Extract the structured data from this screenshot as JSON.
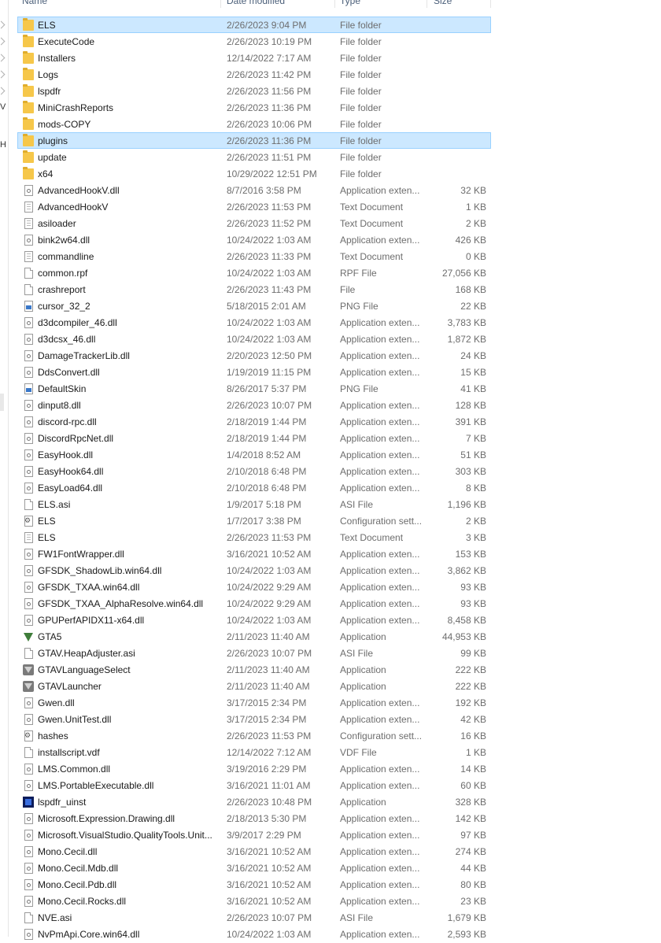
{
  "header": {
    "name": "Name",
    "date_modified": "Date modified",
    "type": "Type",
    "size": "Size"
  },
  "nav_fragments": [
    "V",
    "H"
  ],
  "files": [
    {
      "name": "ELS",
      "date": "2/26/2023 9:04 PM",
      "type": "File folder",
      "size": "",
      "icon": "folder",
      "selected": "hover"
    },
    {
      "name": "ExecuteCode",
      "date": "2/26/2023 10:19 PM",
      "type": "File folder",
      "size": "",
      "icon": "folder"
    },
    {
      "name": "Installers",
      "date": "12/14/2022 7:17 AM",
      "type": "File folder",
      "size": "",
      "icon": "folder"
    },
    {
      "name": "Logs",
      "date": "2/26/2023 11:42 PM",
      "type": "File folder",
      "size": "",
      "icon": "folder"
    },
    {
      "name": "lspdfr",
      "date": "2/26/2023 11:56 PM",
      "type": "File folder",
      "size": "",
      "icon": "folder"
    },
    {
      "name": "MiniCrashReports",
      "date": "2/26/2023 11:36 PM",
      "type": "File folder",
      "size": "",
      "icon": "folder"
    },
    {
      "name": "mods-COPY",
      "date": "2/26/2023 10:06 PM",
      "type": "File folder",
      "size": "",
      "icon": "folder"
    },
    {
      "name": "plugins",
      "date": "2/26/2023 11:36 PM",
      "type": "File folder",
      "size": "",
      "icon": "folder",
      "selected": "true"
    },
    {
      "name": "update",
      "date": "2/26/2023 11:51 PM",
      "type": "File folder",
      "size": "",
      "icon": "folder"
    },
    {
      "name": "x64",
      "date": "10/29/2022 12:51 PM",
      "type": "File folder",
      "size": "",
      "icon": "folder"
    },
    {
      "name": "AdvancedHookV.dll",
      "date": "8/7/2016 3:58 PM",
      "type": "Application exten...",
      "size": "32 KB",
      "icon": "dll"
    },
    {
      "name": "AdvancedHookV",
      "date": "2/26/2023 11:53 PM",
      "type": "Text Document",
      "size": "1 KB",
      "icon": "txt"
    },
    {
      "name": "asiloader",
      "date": "2/26/2023 11:52 PM",
      "type": "Text Document",
      "size": "2 KB",
      "icon": "txt"
    },
    {
      "name": "bink2w64.dll",
      "date": "10/24/2022 1:03 AM",
      "type": "Application exten...",
      "size": "426 KB",
      "icon": "dll"
    },
    {
      "name": "commandline",
      "date": "2/26/2023 11:33 PM",
      "type": "Text Document",
      "size": "0 KB",
      "icon": "txt"
    },
    {
      "name": "common.rpf",
      "date": "10/24/2022 1:03 AM",
      "type": "RPF File",
      "size": "27,056 KB",
      "icon": "doc"
    },
    {
      "name": "crashreport",
      "date": "2/26/2023 11:43 PM",
      "type": "File",
      "size": "168 KB",
      "icon": "doc"
    },
    {
      "name": "cursor_32_2",
      "date": "5/18/2015 2:01 AM",
      "type": "PNG File",
      "size": "22 KB",
      "icon": "png"
    },
    {
      "name": "d3dcompiler_46.dll",
      "date": "10/24/2022 1:03 AM",
      "type": "Application exten...",
      "size": "3,783 KB",
      "icon": "dll"
    },
    {
      "name": "d3dcsx_46.dll",
      "date": "10/24/2022 1:03 AM",
      "type": "Application exten...",
      "size": "1,872 KB",
      "icon": "dll"
    },
    {
      "name": "DamageTrackerLib.dll",
      "date": "2/20/2023 12:50 PM",
      "type": "Application exten...",
      "size": "24 KB",
      "icon": "dll"
    },
    {
      "name": "DdsConvert.dll",
      "date": "1/19/2019 11:15 PM",
      "type": "Application exten...",
      "size": "15 KB",
      "icon": "dll"
    },
    {
      "name": "DefaultSkin",
      "date": "8/26/2017 5:37 PM",
      "type": "PNG File",
      "size": "41 KB",
      "icon": "png"
    },
    {
      "name": "dinput8.dll",
      "date": "2/26/2023 10:07 PM",
      "type": "Application exten...",
      "size": "128 KB",
      "icon": "dll"
    },
    {
      "name": "discord-rpc.dll",
      "date": "2/18/2019 1:44 PM",
      "type": "Application exten...",
      "size": "391 KB",
      "icon": "dll"
    },
    {
      "name": "DiscordRpcNet.dll",
      "date": "2/18/2019 1:44 PM",
      "type": "Application exten...",
      "size": "7 KB",
      "icon": "dll"
    },
    {
      "name": "EasyHook.dll",
      "date": "1/4/2018 8:52 AM",
      "type": "Application exten...",
      "size": "51 KB",
      "icon": "dll"
    },
    {
      "name": "EasyHook64.dll",
      "date": "2/10/2018 6:48 PM",
      "type": "Application exten...",
      "size": "303 KB",
      "icon": "dll"
    },
    {
      "name": "EasyLoad64.dll",
      "date": "2/10/2018 6:48 PM",
      "type": "Application exten...",
      "size": "8 KB",
      "icon": "dll"
    },
    {
      "name": "ELS.asi",
      "date": "1/9/2017 5:18 PM",
      "type": "ASI File",
      "size": "1,196 KB",
      "icon": "doc"
    },
    {
      "name": "ELS",
      "date": "1/7/2017 3:38 PM",
      "type": "Configuration sett...",
      "size": "2 KB",
      "icon": "cfg"
    },
    {
      "name": "ELS",
      "date": "2/26/2023 11:53 PM",
      "type": "Text Document",
      "size": "3 KB",
      "icon": "txt"
    },
    {
      "name": "FW1FontWrapper.dll",
      "date": "3/16/2021 10:52 AM",
      "type": "Application exten...",
      "size": "153 KB",
      "icon": "dll"
    },
    {
      "name": "GFSDK_ShadowLib.win64.dll",
      "date": "10/24/2022 1:03 AM",
      "type": "Application exten...",
      "size": "3,862 KB",
      "icon": "dll"
    },
    {
      "name": "GFSDK_TXAA.win64.dll",
      "date": "10/24/2022 9:29 AM",
      "type": "Application exten...",
      "size": "93 KB",
      "icon": "dll"
    },
    {
      "name": "GFSDK_TXAA_AlphaResolve.win64.dll",
      "date": "10/24/2022 9:29 AM",
      "type": "Application exten...",
      "size": "93 KB",
      "icon": "dll"
    },
    {
      "name": "GPUPerfAPIDX11-x64.dll",
      "date": "10/24/2022 1:03 AM",
      "type": "Application exten...",
      "size": "8,458 KB",
      "icon": "dll"
    },
    {
      "name": "GTA5",
      "date": "2/11/2023 11:40 AM",
      "type": "Application",
      "size": "44,953 KB",
      "icon": "gta"
    },
    {
      "name": "GTAV.HeapAdjuster.asi",
      "date": "2/26/2023 10:07 PM",
      "type": "ASI File",
      "size": "99 KB",
      "icon": "doc"
    },
    {
      "name": "GTAVLanguageSelect",
      "date": "2/11/2023 11:40 AM",
      "type": "Application",
      "size": "222 KB",
      "icon": "gtagray"
    },
    {
      "name": "GTAVLauncher",
      "date": "2/11/2023 11:40 AM",
      "type": "Application",
      "size": "222 KB",
      "icon": "gtagray"
    },
    {
      "name": "Gwen.dll",
      "date": "3/17/2015 2:34 PM",
      "type": "Application exten...",
      "size": "192 KB",
      "icon": "dll"
    },
    {
      "name": "Gwen.UnitTest.dll",
      "date": "3/17/2015 2:34 PM",
      "type": "Application exten...",
      "size": "42 KB",
      "icon": "dll"
    },
    {
      "name": "hashes",
      "date": "2/26/2023 11:53 PM",
      "type": "Configuration sett...",
      "size": "16 KB",
      "icon": "cfg"
    },
    {
      "name": "installscript.vdf",
      "date": "12/14/2022 7:12 AM",
      "type": "VDF File",
      "size": "1 KB",
      "icon": "doc"
    },
    {
      "name": "LMS.Common.dll",
      "date": "3/19/2016 2:29 PM",
      "type": "Application exten...",
      "size": "14 KB",
      "icon": "dll"
    },
    {
      "name": "LMS.PortableExecutable.dll",
      "date": "3/16/2021 11:01 AM",
      "type": "Application exten...",
      "size": "60 KB",
      "icon": "dll"
    },
    {
      "name": "lspdfr_uinst",
      "date": "2/26/2023 10:48 PM",
      "type": "Application",
      "size": "328 KB",
      "icon": "lspd"
    },
    {
      "name": "Microsoft.Expression.Drawing.dll",
      "date": "2/18/2013 5:30 PM",
      "type": "Application exten...",
      "size": "142 KB",
      "icon": "dll"
    },
    {
      "name": "Microsoft.VisualStudio.QualityTools.Unit...",
      "date": "3/9/2017 2:29 PM",
      "type": "Application exten...",
      "size": "97 KB",
      "icon": "dll"
    },
    {
      "name": "Mono.Cecil.dll",
      "date": "3/16/2021 10:52 AM",
      "type": "Application exten...",
      "size": "274 KB",
      "icon": "dll"
    },
    {
      "name": "Mono.Cecil.Mdb.dll",
      "date": "3/16/2021 10:52 AM",
      "type": "Application exten...",
      "size": "44 KB",
      "icon": "dll"
    },
    {
      "name": "Mono.Cecil.Pdb.dll",
      "date": "3/16/2021 10:52 AM",
      "type": "Application exten...",
      "size": "80 KB",
      "icon": "dll"
    },
    {
      "name": "Mono.Cecil.Rocks.dll",
      "date": "3/16/2021 10:52 AM",
      "type": "Application exten...",
      "size": "23 KB",
      "icon": "dll"
    },
    {
      "name": "NVE.asi",
      "date": "2/26/2023 10:07 PM",
      "type": "ASI File",
      "size": "1,679 KB",
      "icon": "doc"
    },
    {
      "name": "NvPmApi.Core.win64.dll",
      "date": "10/24/2022 1:03 AM",
      "type": "Application exten...",
      "size": "2,593 KB",
      "icon": "dll"
    }
  ],
  "colors": {
    "selection_bg": "#cce8ff",
    "selection_border": "#99d1ff",
    "folder": "#f6c74a",
    "secondary_text": "#6d6d6d"
  }
}
